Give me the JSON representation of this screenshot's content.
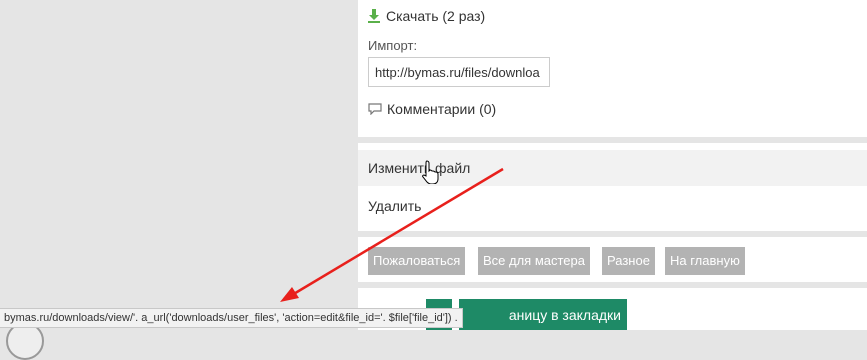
{
  "file": {
    "download_label": "Скачать (2 раз)",
    "import_label": "Импорт:",
    "import_value": "http://bymas.ru/files/downloa",
    "comments_label": "Комментарии (0)"
  },
  "actions": {
    "edit_label": "Изменить файл",
    "delete_label": "Удалить"
  },
  "tags": [
    {
      "label": "Пожаловаться"
    },
    {
      "label": "Все для мастера"
    },
    {
      "label": "Разное"
    },
    {
      "label": "На главную"
    }
  ],
  "bookmarks": {
    "label": "аницу в закладки"
  },
  "statusbar": {
    "text": "bymas.ru/downloads/view/'. a_url('downloads/user_files', 'action=edit&file_id='. $file['file_id']) ."
  },
  "colors": {
    "accent_green": "#1e8a66",
    "tag_gray": "#b3b3b3",
    "annotation_red": "#e8201c",
    "download_icon": "#5ab04a"
  },
  "icons": {
    "download": "download-arrow-icon",
    "comment": "speech-bubble-icon",
    "cursor": "hand-pointer-icon"
  }
}
